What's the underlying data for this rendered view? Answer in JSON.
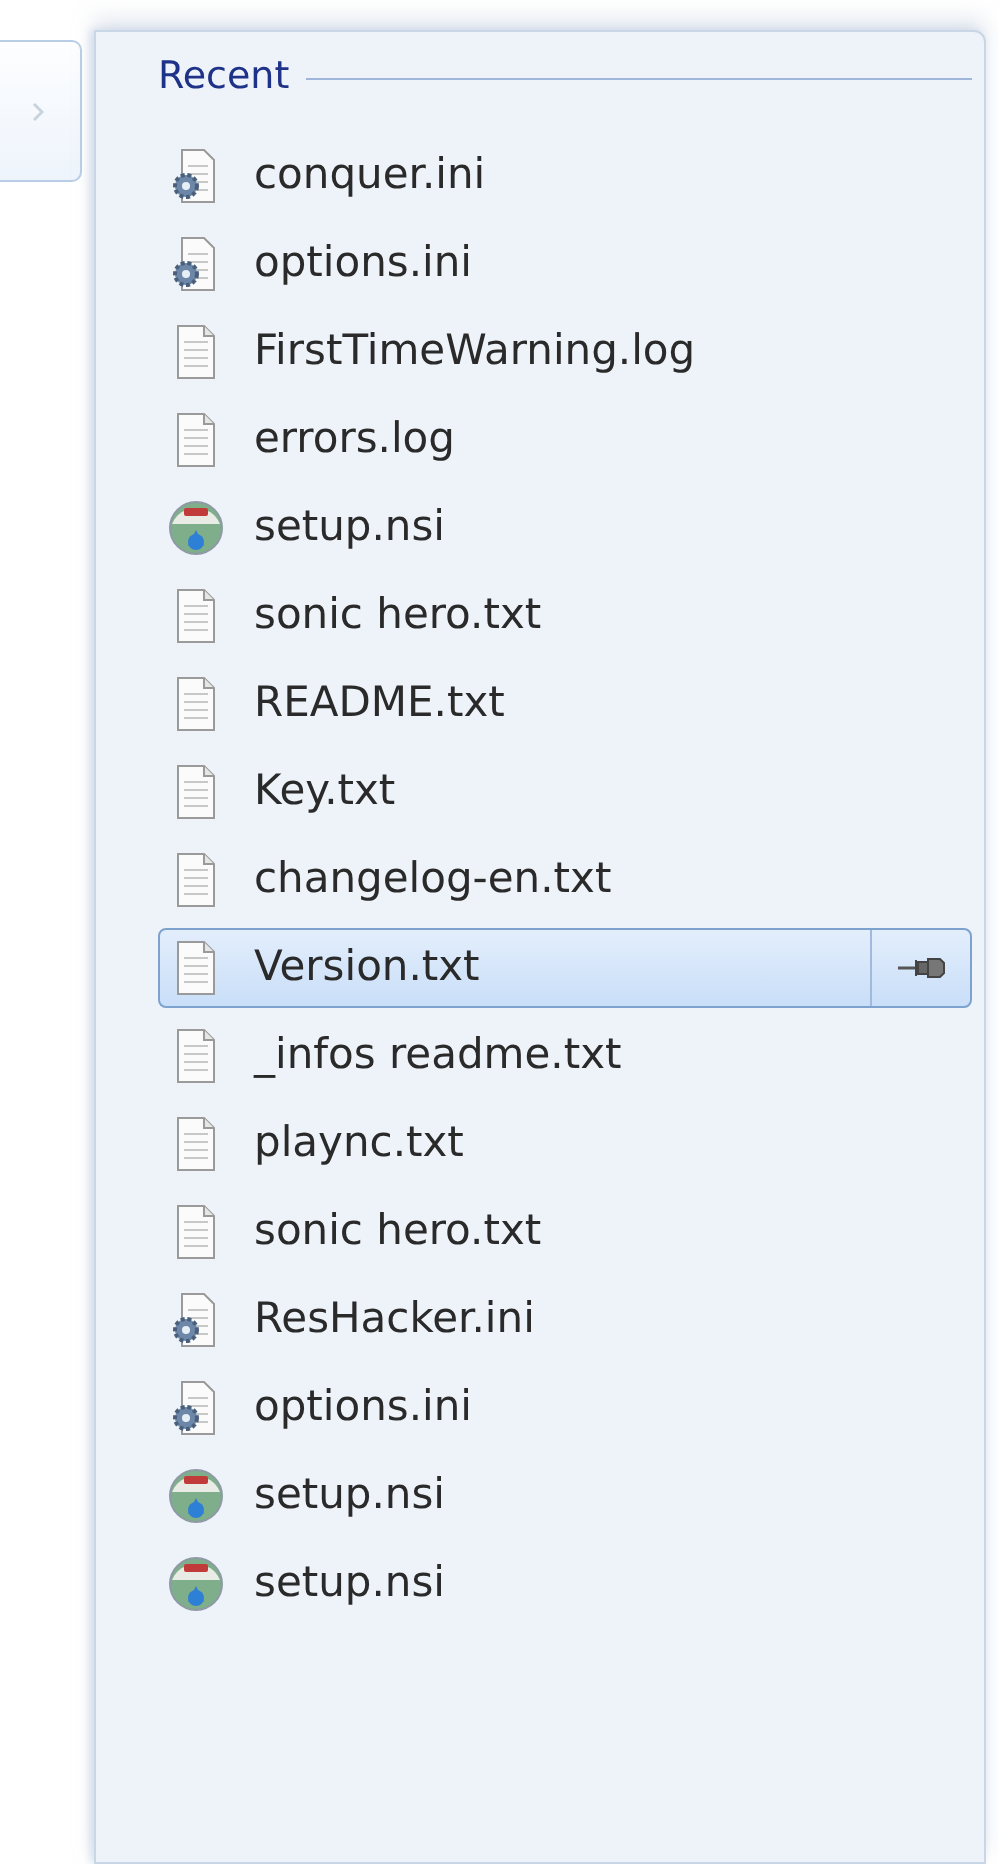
{
  "section": {
    "title": "Recent"
  },
  "items": [
    {
      "label": "conquer.ini",
      "kind": "ini",
      "selected": false
    },
    {
      "label": "options.ini",
      "kind": "ini",
      "selected": false
    },
    {
      "label": "FirstTimeWarning.log",
      "kind": "text",
      "selected": false
    },
    {
      "label": "errors.log",
      "kind": "text",
      "selected": false
    },
    {
      "label": "setup.nsi",
      "kind": "nsi",
      "selected": false
    },
    {
      "label": "sonic hero.txt",
      "kind": "text",
      "selected": false
    },
    {
      "label": "README.txt",
      "kind": "text",
      "selected": false
    },
    {
      "label": "Key.txt",
      "kind": "text",
      "selected": false
    },
    {
      "label": "changelog-en.txt",
      "kind": "text",
      "selected": false
    },
    {
      "label": "Version.txt",
      "kind": "text",
      "selected": true
    },
    {
      "label": "_infos readme.txt",
      "kind": "text",
      "selected": false
    },
    {
      "label": "plaync.txt",
      "kind": "text",
      "selected": false
    },
    {
      "label": "sonic hero.txt",
      "kind": "text",
      "selected": false
    },
    {
      "label": "ResHacker.ini",
      "kind": "ini",
      "selected": false
    },
    {
      "label": "options.ini",
      "kind": "ini",
      "selected": false
    },
    {
      "label": "setup.nsi",
      "kind": "nsi",
      "selected": false
    },
    {
      "label": "setup.nsi",
      "kind": "nsi",
      "selected": false
    }
  ]
}
